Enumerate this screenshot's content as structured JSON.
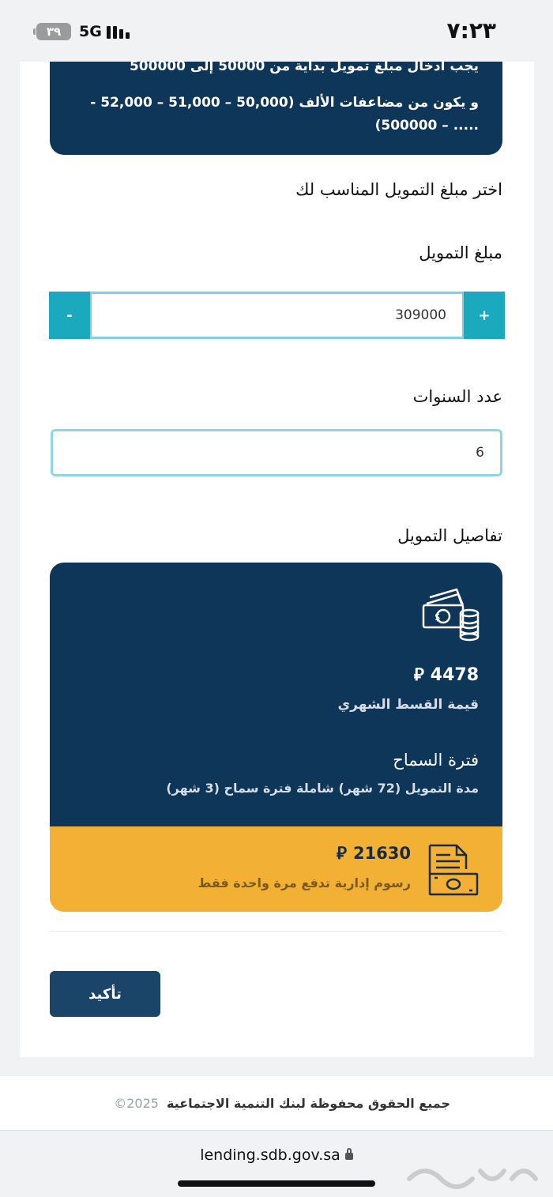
{
  "status_bar": {
    "time": "٧:٢٣",
    "battery": "٣٩",
    "network": "5G"
  },
  "info_box": {
    "line1": "يجب ادخال مبلغ تمويل بداية من 50000 إلى 500000",
    "line2": "و يكون من مضاعفات الألف (50,000 – 51,000 – 52,000 - ..... – 500000)"
  },
  "form": {
    "choose_label": "اختر مبلغ التمويل المناسب لك",
    "amount_label": "مبلغ التمويل",
    "amount_value": "309000",
    "minus_label": "-",
    "plus_label": "+",
    "years_label": "عدد السنوات",
    "years_value": "6"
  },
  "details": {
    "section_title": "تفاصيل التمويل",
    "monthly_installment": "4478",
    "currency_symbol": "⃁",
    "installment_label": "قيمة القسط الشهري",
    "grace_title": "فترة السماح",
    "grace_desc": "مدة التمويل (72 شهر) شاملة فترة سماح (3 شهر)",
    "admin_fee": "21630",
    "admin_fee_label": "رسوم إدارية تدفع مرة واحدة فقط",
    "icons": [
      "money-icon",
      "document-money-icon"
    ],
    "colors": {
      "primary": "#0e3659",
      "accent": "#f2b134",
      "teal": "#1ba9bd"
    }
  },
  "actions": {
    "confirm_label": "تأكيد"
  },
  "footer": {
    "text": "جميع الحقوق محفوظة لبنك التنمية الاجتماعية",
    "year": "©2025"
  },
  "browser": {
    "url": "lending.sdb.gov.sa"
  }
}
